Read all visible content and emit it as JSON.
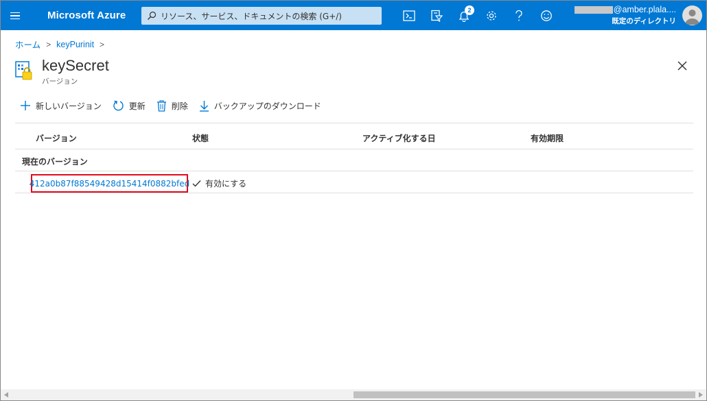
{
  "topbar": {
    "brand": "Microsoft Azure",
    "search_placeholder": "リソース、サービス、ドキュメントの検索 (G+/)",
    "notification_count": "2",
    "account_email": "@amber.plala....",
    "account_directory": "既定のディレクトリ",
    "accent_color": "#0078d4"
  },
  "breadcrumb": {
    "home": "ホーム",
    "parent": "keyPurinit"
  },
  "header": {
    "title": "keySecret",
    "subtitle": "バージョン"
  },
  "toolbar": {
    "new_version": "新しいバージョン",
    "refresh": "更新",
    "delete": "削除",
    "download_backup": "バックアップのダウンロード"
  },
  "table": {
    "columns": [
      "バージョン",
      "状態",
      "アクティブ化する日",
      "有効期限"
    ],
    "group_label": "現在のバージョン",
    "rows": [
      {
        "version": "412a0b87f88549428d15414f0882bfed",
        "status": "有効にする",
        "activation_date": "",
        "expiration": ""
      }
    ]
  }
}
